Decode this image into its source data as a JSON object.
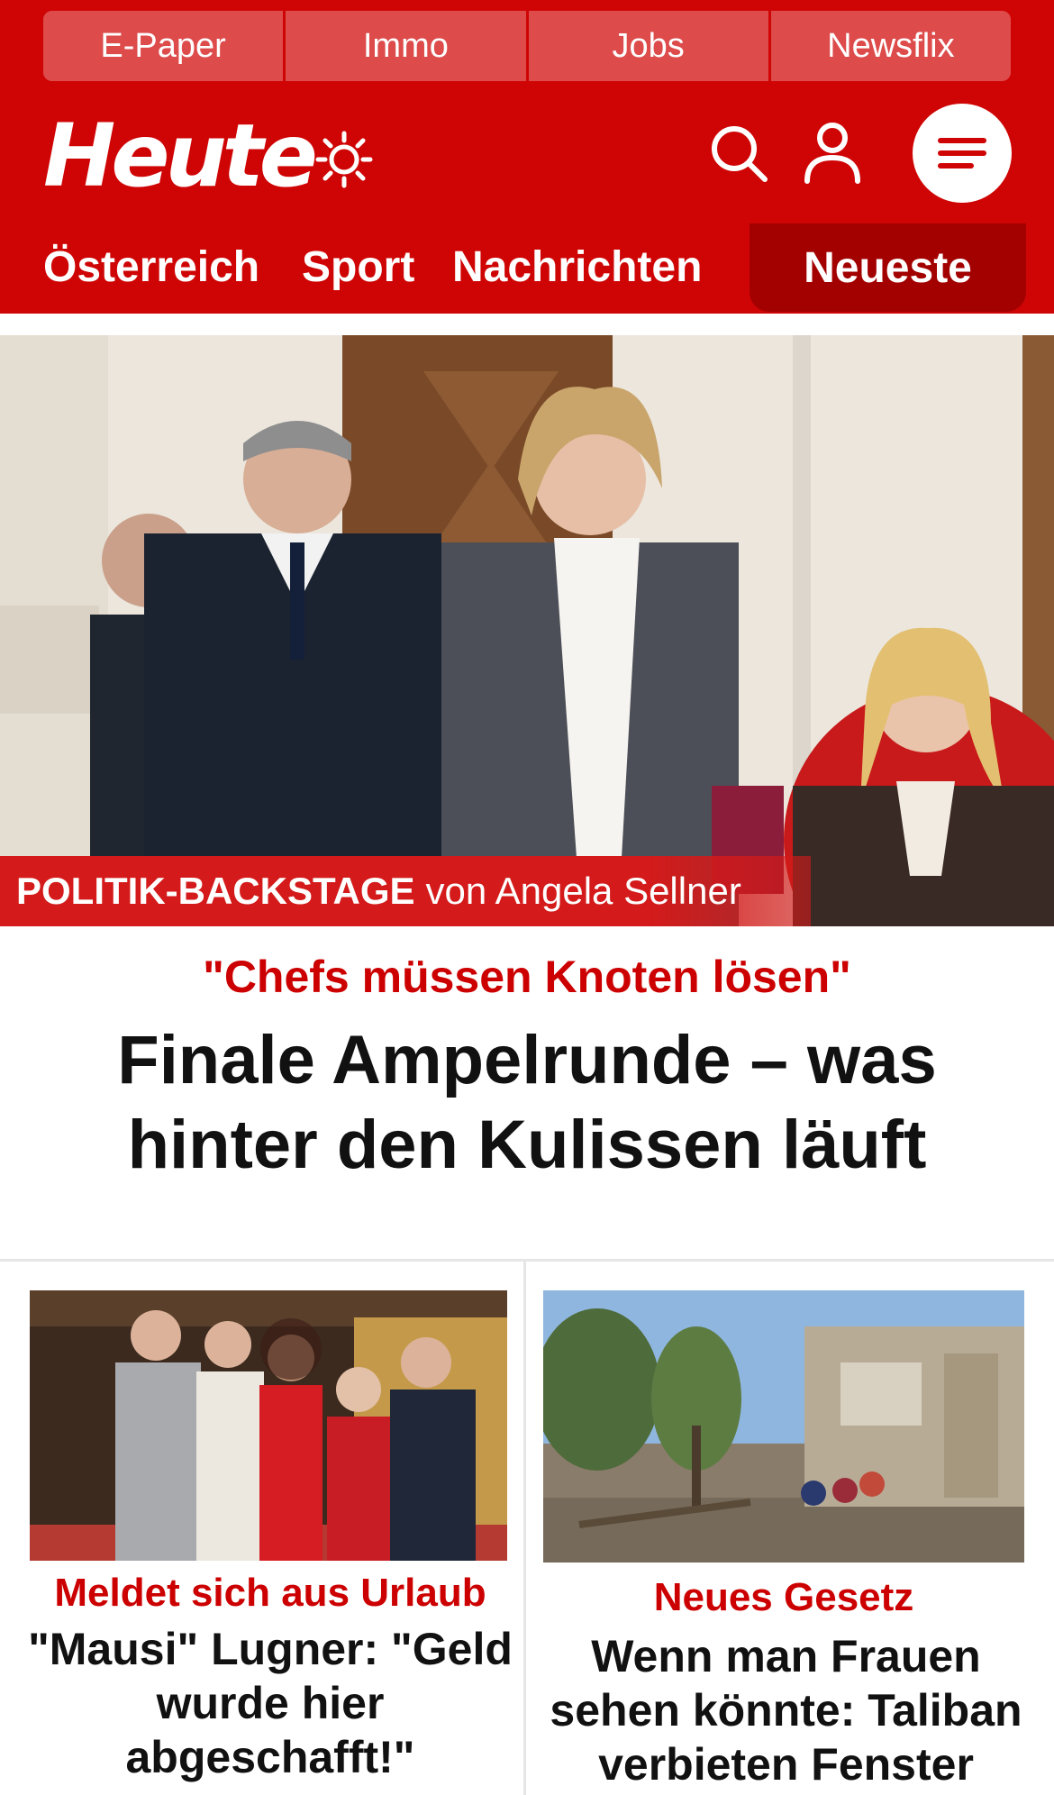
{
  "header": {
    "external_links": [
      "E-Paper",
      "Immo",
      "Jobs",
      "Newsflix"
    ],
    "logo_text": "Heute",
    "icons": {
      "theme": "sun-icon",
      "search": "search-icon",
      "account": "user-icon",
      "menu": "menu-icon"
    },
    "nav": {
      "items": [
        "Österreich",
        "Sport",
        "Nachrichten"
      ],
      "active": "Neueste"
    },
    "colors": {
      "brand_red": "#cf0505",
      "active_tab": "#a30000",
      "kicker_red": "#cc0000"
    }
  },
  "hero": {
    "image_bar_strong": "POLITIK-BACKSTAGE",
    "image_bar_rest": "von Angela Sellner",
    "kicker": "\"Chefs müssen Knoten lösen\"",
    "headline": "Finale Ampelrunde – was hinter den Kulissen läuft"
  },
  "teasers": [
    {
      "kicker": "Meldet sich aus Urlaub",
      "headline": "\"Mausi\" Lugner: \"Geld wurde hier abgeschafft!\""
    },
    {
      "kicker": "Neues Gesetz",
      "headline": "Wenn man Frauen sehen könnte: Taliban verbieten Fenster"
    }
  ]
}
